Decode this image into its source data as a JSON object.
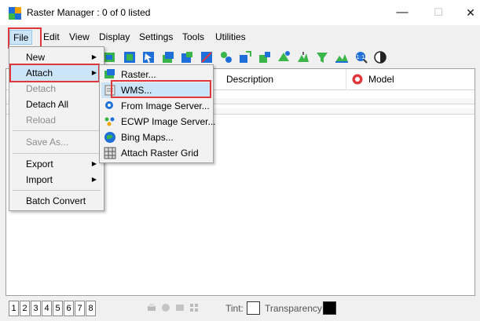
{
  "window": {
    "title": "Raster Manager : 0 of 0 listed",
    "controls": {
      "minimize": "—",
      "maximize": "☐",
      "close": "✕"
    }
  },
  "menubar": {
    "items": [
      "File",
      "Edit",
      "View",
      "Display",
      "Settings",
      "Tools",
      "Utilities"
    ]
  },
  "columns": {
    "description": "Description",
    "model": "Model"
  },
  "file_menu": {
    "items": [
      {
        "label": "New",
        "has_submenu": true,
        "enabled": true
      },
      {
        "label": "Attach",
        "has_submenu": true,
        "enabled": true,
        "highlighted": true
      },
      {
        "label": "Detach",
        "enabled": false
      },
      {
        "label": "Detach All",
        "enabled": true
      },
      {
        "label": "Reload",
        "enabled": false
      },
      {
        "label": "Save As...",
        "enabled": false
      },
      {
        "label": "Export",
        "has_submenu": true,
        "enabled": true
      },
      {
        "label": "Import",
        "has_submenu": true,
        "enabled": true
      },
      {
        "label": "Batch Convert",
        "enabled": true
      }
    ]
  },
  "attach_menu": {
    "items": [
      {
        "label": "Raster...",
        "icon": "raster-icon"
      },
      {
        "label": "WMS...",
        "icon": "wms-icon",
        "highlighted": true
      },
      {
        "label": "From Image Server...",
        "icon": "image-server-icon"
      },
      {
        "label": "ECWP Image Server...",
        "icon": "ecwp-icon"
      },
      {
        "label": "Bing Maps...",
        "icon": "bing-maps-icon"
      },
      {
        "label": "Attach Raster Grid",
        "icon": "raster-grid-icon"
      }
    ]
  },
  "statusbar": {
    "view_buttons": [
      "1",
      "2",
      "3",
      "4",
      "5",
      "6",
      "7",
      "8"
    ],
    "tint_label": "Tint:",
    "transparency_label": "Transparency:"
  },
  "colors": {
    "highlight": "#cce4f7",
    "annotation_red": "#e0383a",
    "transparency_swatch": "#000000",
    "tint_swatch": "#ffffff"
  }
}
